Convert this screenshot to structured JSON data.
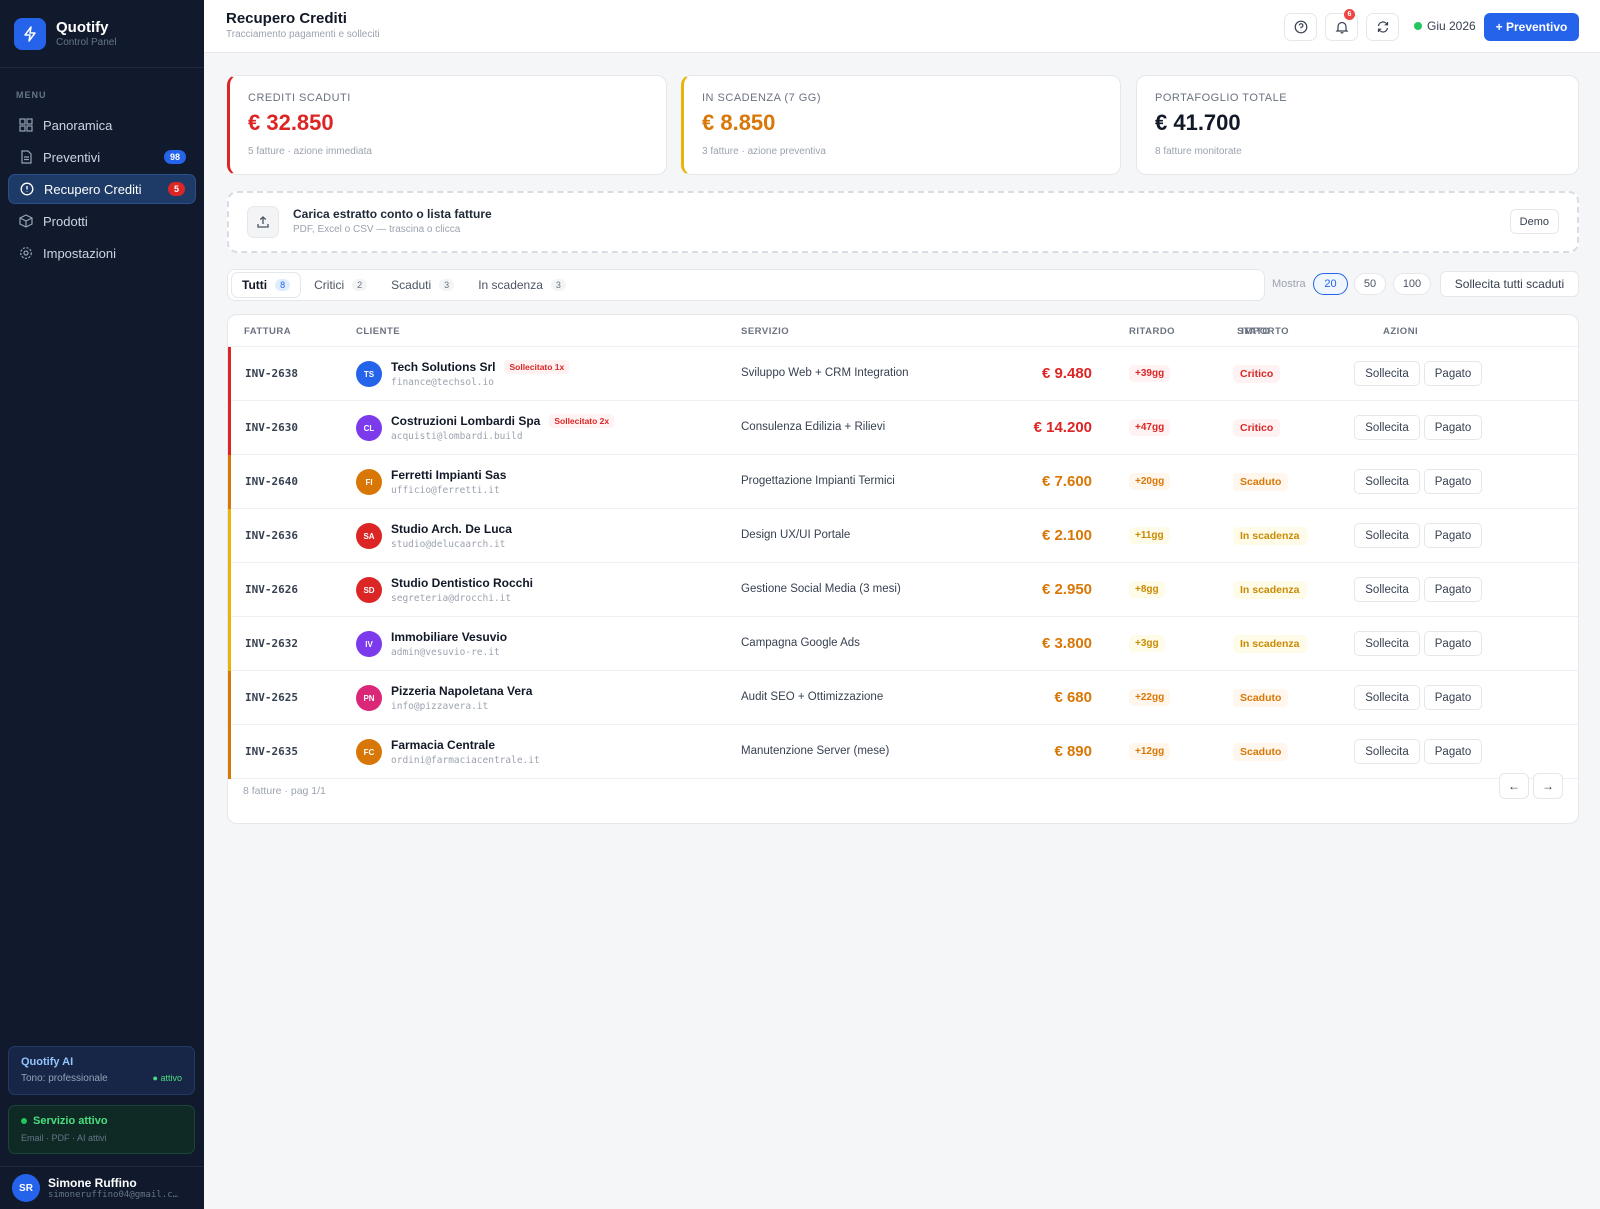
{
  "app": {
    "name": "Quotify",
    "subtitle": "Control Panel"
  },
  "sidebar": {
    "menu_label": "MENU",
    "items": [
      {
        "label": "Panoramica",
        "icon": "grid-icon"
      },
      {
        "label": "Preventivi",
        "icon": "document-icon",
        "badge": "98"
      },
      {
        "label": "Recupero Crediti",
        "icon": "alert-circle-icon",
        "badge": "5",
        "active": true
      },
      {
        "label": "Prodotti",
        "icon": "box-icon"
      },
      {
        "label": "Impostazioni",
        "icon": "gear-icon"
      }
    ],
    "ai": {
      "title": "Quotify AI",
      "tone": "Tono: professionale",
      "status": "● attivo"
    },
    "service": {
      "title": "Servizio attivo",
      "sub": "Email · PDF · AI attivi"
    },
    "user": {
      "initials": "SR",
      "name": "Simone Ruffino",
      "email": "simoneruffino04@gmail.c…"
    }
  },
  "header": {
    "title": "Recupero Crediti",
    "subtitle": "Tracciamento pagamenti e solleciti",
    "notifications": "6",
    "period": "Giu 2026",
    "new_button": "+ Preventivo"
  },
  "cards": [
    {
      "label": "CREDITI SCADUTI",
      "value": "€ 32.850",
      "sub": "5 fatture · azione immediata",
      "color": "#dc2626"
    },
    {
      "label": "IN SCADENZA (7 GG)",
      "value": "€ 8.850",
      "sub": "3 fatture · azione preventiva",
      "color": "#d97706"
    },
    {
      "label": "PORTAFOGLIO TOTALE",
      "value": "€ 41.700",
      "sub": "8 fatture monitorate",
      "color": "#111827"
    }
  ],
  "upload": {
    "title": "Carica estratto conto o lista fatture",
    "sub": "PDF, Excel o CSV — trascina o clicca",
    "demo": "Demo"
  },
  "filters": {
    "tabs": [
      {
        "label": "Tutti",
        "count": "8"
      },
      {
        "label": "Critici",
        "count": "2"
      },
      {
        "label": "Scaduti",
        "count": "3"
      },
      {
        "label": "In scadenza",
        "count": "3"
      }
    ],
    "show_label": "Mostra",
    "page_sizes": [
      "20",
      "50",
      "100"
    ],
    "selected_page_size": "20",
    "remind_all": "Sollecita tutti scaduti"
  },
  "table": {
    "columns": [
      "FATTURA",
      "CLIENTE",
      "SERVIZIO",
      "IMPORTO",
      "RITARDO",
      "STATO",
      "AZIONI"
    ],
    "action_remind": "Sollecita",
    "action_paid": "Pagato",
    "rows": [
      {
        "invoice": "INV-2638",
        "initials": "TS",
        "avatar": "#2563eb",
        "client": "Tech Solutions Srl",
        "tag": "Sollecitato 1x",
        "email": "finance@techsol.io",
        "service": "Sviluppo Web + CRM Integration",
        "amount": "€ 9.480",
        "delay": "+39gg",
        "status": "Critico",
        "level": "critical"
      },
      {
        "invoice": "INV-2630",
        "initials": "CL",
        "avatar": "#7c3aed",
        "client": "Costruzioni Lombardi Spa",
        "tag": "Sollecitato 2x",
        "email": "acquisti@lombardi.build",
        "service": "Consulenza Edilizia + Rilievi",
        "amount": "€ 14.200",
        "delay": "+47gg",
        "status": "Critico",
        "level": "critical"
      },
      {
        "invoice": "INV-2640",
        "initials": "FI",
        "avatar": "#d97706",
        "client": "Ferretti Impianti Sas",
        "tag": "",
        "email": "ufficio@ferretti.it",
        "service": "Progettazione Impianti Termici",
        "amount": "€ 7.600",
        "delay": "+20gg",
        "status": "Scaduto",
        "level": "overdue"
      },
      {
        "invoice": "INV-2636",
        "initials": "SA",
        "avatar": "#dc2626",
        "client": "Studio Arch. De Luca",
        "tag": "",
        "email": "studio@delucaarch.it",
        "service": "Design UX/UI Portale",
        "amount": "€ 2.100",
        "delay": "+11gg",
        "status": "In scadenza",
        "level": "due"
      },
      {
        "invoice": "INV-2626",
        "initials": "SD",
        "avatar": "#dc2626",
        "client": "Studio Dentistico Rocchi",
        "tag": "",
        "email": "segreteria@drocchi.it",
        "service": "Gestione Social Media (3 mesi)",
        "amount": "€ 2.950",
        "delay": "+8gg",
        "status": "In scadenza",
        "level": "due"
      },
      {
        "invoice": "INV-2632",
        "initials": "IV",
        "avatar": "#7c3aed",
        "client": "Immobiliare Vesuvio",
        "tag": "",
        "email": "admin@vesuvio-re.it",
        "service": "Campagna Google Ads",
        "amount": "€ 3.800",
        "delay": "+3gg",
        "status": "In scadenza",
        "level": "due"
      },
      {
        "invoice": "INV-2625",
        "initials": "PN",
        "avatar": "#db2777",
        "client": "Pizzeria Napoletana Vera",
        "tag": "",
        "email": "info@pizzavera.it",
        "service": "Audit SEO + Ottimizzazione",
        "amount": "€ 680",
        "delay": "+22gg",
        "status": "Scaduto",
        "level": "overdue"
      },
      {
        "invoice": "INV-2635",
        "initials": "FC",
        "avatar": "#d97706",
        "client": "Farmacia Centrale",
        "tag": "",
        "email": "ordini@farmaciacentrale.it",
        "service": "Manutenzione Server (mese)",
        "amount": "€ 890",
        "delay": "+12gg",
        "status": "Scaduto",
        "level": "overdue"
      }
    ],
    "footer": "8 fatture · pag 1/1",
    "prev": "←",
    "next": "→"
  },
  "colors": {
    "critical": "#dc2626",
    "overdue": "#d97706",
    "due": "#eab308",
    "accent": "#2563eb"
  }
}
